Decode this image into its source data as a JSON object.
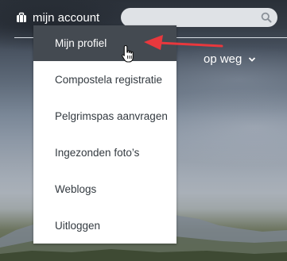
{
  "header": {
    "account_label": "mijn account",
    "search_placeholder": "",
    "search_value": ""
  },
  "nav": {
    "op_weg_label": "op weg"
  },
  "account_menu": {
    "items": [
      {
        "label": "Mijn profiel",
        "active": true
      },
      {
        "label": "Compostela registratie",
        "active": false
      },
      {
        "label": "Pelgrimspas aanvragen",
        "active": false
      },
      {
        "label": "Ingezonden foto’s",
        "active": false
      },
      {
        "label": "Weblogs",
        "active": false
      },
      {
        "label": "Uitloggen",
        "active": false
      }
    ]
  },
  "colors": {
    "menu_active_bg": "#444a51",
    "menu_bg": "#ffffff",
    "annotation_arrow": "#e8383d",
    "search_bg": "#dfe2e6"
  },
  "icons": {
    "account": "briefcase-icon",
    "search": "search-icon",
    "dropdown": "chevron-down-icon",
    "pointer": "hand-cursor-icon",
    "annotation": "arrow-icon"
  }
}
